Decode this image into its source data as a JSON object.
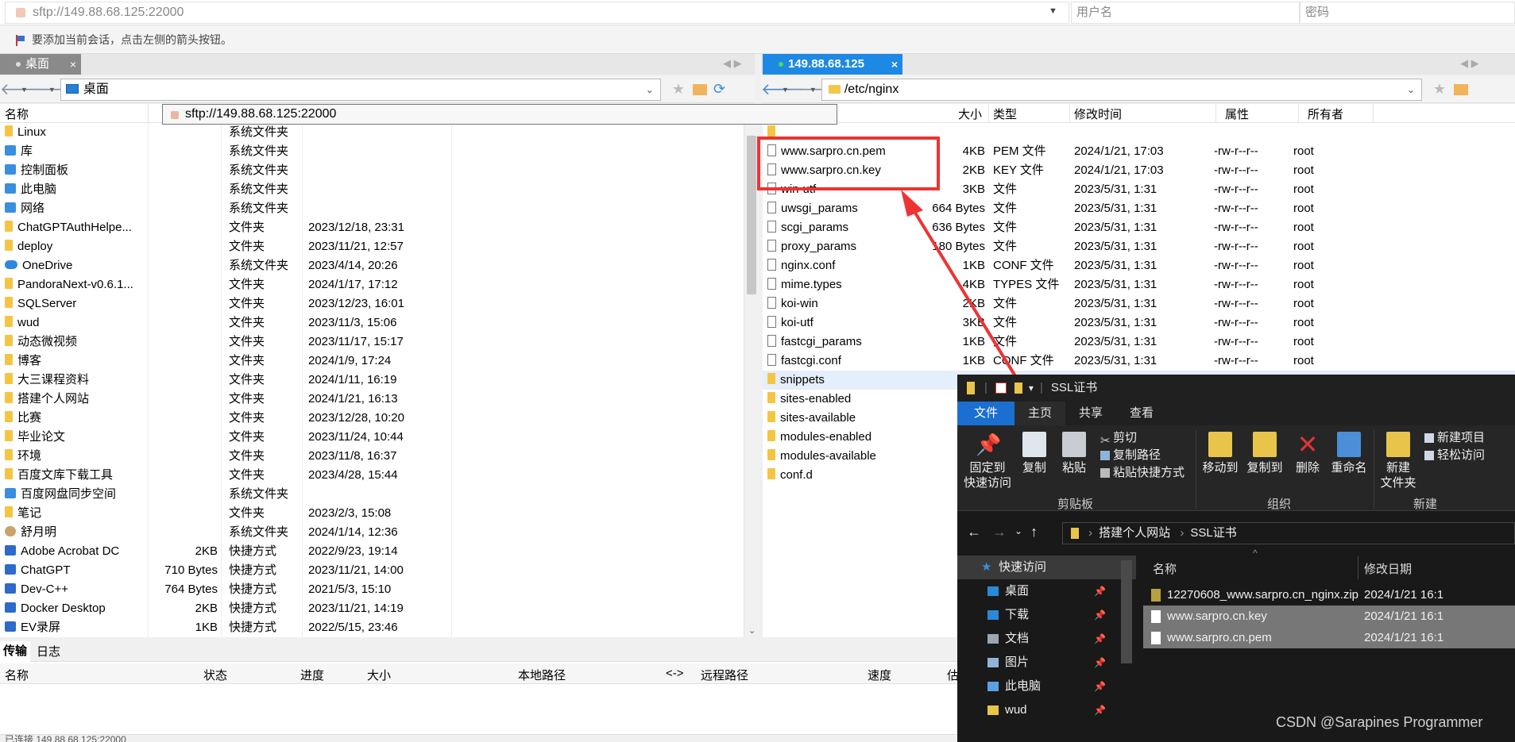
{
  "address": {
    "url": "sftp://149.88.68.125:22000",
    "user_placeholder": "用户名",
    "pass_placeholder": "密码"
  },
  "hint": "要添加当前会话，点击左侧的箭头按钮。",
  "left": {
    "tab": "桌面",
    "path": "桌面",
    "tooltip": "sftp://149.88.68.125:22000",
    "headers": {
      "name": "名称",
      "size": "大小",
      "type": "类型",
      "modified": "修改时间"
    },
    "files": [
      {
        "name": "Linux",
        "size": "",
        "type": "系统文件夹",
        "date": "",
        "icon": "folder"
      },
      {
        "name": "库",
        "size": "",
        "type": "系统文件夹",
        "date": "",
        "icon": "sys"
      },
      {
        "name": "控制面板",
        "size": "",
        "type": "系统文件夹",
        "date": "",
        "icon": "sys"
      },
      {
        "name": "此电脑",
        "size": "",
        "type": "系统文件夹",
        "date": "",
        "icon": "sys"
      },
      {
        "name": "网络",
        "size": "",
        "type": "系统文件夹",
        "date": "",
        "icon": "sys"
      },
      {
        "name": "ChatGPTAuthHelpe...",
        "size": "",
        "type": "文件夹",
        "date": "2023/12/18, 23:31",
        "icon": "folder"
      },
      {
        "name": "deploy",
        "size": "",
        "type": "文件夹",
        "date": "2023/11/21, 12:57",
        "icon": "folder"
      },
      {
        "name": "OneDrive",
        "size": "",
        "type": "系统文件夹",
        "date": "2023/4/14, 20:26",
        "icon": "cloud"
      },
      {
        "name": "PandoraNext-v0.6.1...",
        "size": "",
        "type": "文件夹",
        "date": "2024/1/17, 17:12",
        "icon": "folder"
      },
      {
        "name": "SQLServer",
        "size": "",
        "type": "文件夹",
        "date": "2023/12/23, 16:01",
        "icon": "folder"
      },
      {
        "name": "wud",
        "size": "",
        "type": "文件夹",
        "date": "2023/11/3, 15:06",
        "icon": "folder"
      },
      {
        "name": "动态微视频",
        "size": "",
        "type": "文件夹",
        "date": "2023/11/17, 15:17",
        "icon": "folder"
      },
      {
        "name": "博客",
        "size": "",
        "type": "文件夹",
        "date": "2024/1/9, 17:24",
        "icon": "folder"
      },
      {
        "name": "大三课程资料",
        "size": "",
        "type": "文件夹",
        "date": "2024/1/11, 16:19",
        "icon": "folder"
      },
      {
        "name": "搭建个人网站",
        "size": "",
        "type": "文件夹",
        "date": "2024/1/21, 16:13",
        "icon": "folder"
      },
      {
        "name": "比赛",
        "size": "",
        "type": "文件夹",
        "date": "2023/12/28, 10:20",
        "icon": "folder"
      },
      {
        "name": "毕业论文",
        "size": "",
        "type": "文件夹",
        "date": "2023/11/24, 10:44",
        "icon": "folder"
      },
      {
        "name": "环境",
        "size": "",
        "type": "文件夹",
        "date": "2023/11/8, 16:37",
        "icon": "folder"
      },
      {
        "name": "百度文库下载工具",
        "size": "",
        "type": "文件夹",
        "date": "2023/4/28, 15:44",
        "icon": "folder"
      },
      {
        "name": "百度网盘同步空间",
        "size": "",
        "type": "系统文件夹",
        "date": "",
        "icon": "sys"
      },
      {
        "name": "笔记",
        "size": "",
        "type": "文件夹",
        "date": "2023/2/3, 15:08",
        "icon": "folder"
      },
      {
        "name": "舒月明",
        "size": "",
        "type": "系统文件夹",
        "date": "2024/1/14, 12:36",
        "icon": "user"
      },
      {
        "name": "Adobe Acrobat DC",
        "size": "2KB",
        "type": "快捷方式",
        "date": "2022/9/23, 19:14",
        "icon": "app"
      },
      {
        "name": "ChatGPT",
        "size": "710 Bytes",
        "type": "快捷方式",
        "date": "2023/11/21, 14:00",
        "icon": "app"
      },
      {
        "name": "Dev-C++",
        "size": "764 Bytes",
        "type": "快捷方式",
        "date": "2021/5/3, 15:10",
        "icon": "app"
      },
      {
        "name": "Docker Desktop",
        "size": "2KB",
        "type": "快捷方式",
        "date": "2023/11/21, 14:19",
        "icon": "app"
      },
      {
        "name": "EV录屏",
        "size": "1KB",
        "type": "快捷方式",
        "date": "2022/5/15, 23:46",
        "icon": "app"
      }
    ]
  },
  "right": {
    "tab": "149.88.68.125",
    "path": "/etc/nginx",
    "headers": {
      "size": "大小",
      "type": "类型",
      "modified": "修改时间",
      "attr": "属性",
      "owner": "所有者"
    },
    "files": [
      {
        "name": "www.sarpro.cn.pem",
        "size": "4KB",
        "type": "PEM 文件",
        "date": "2024/1/21, 17:03",
        "attr": "-rw-r--r--",
        "owner": "root",
        "icon": "file"
      },
      {
        "name": "www.sarpro.cn.key",
        "size": "2KB",
        "type": "KEY 文件",
        "date": "2024/1/21, 17:03",
        "attr": "-rw-r--r--",
        "owner": "root",
        "icon": "file"
      },
      {
        "name": "win-utf",
        "size": "3KB",
        "type": "文件",
        "date": "2023/5/31, 1:31",
        "attr": "-rw-r--r--",
        "owner": "root",
        "icon": "file"
      },
      {
        "name": "uwsgi_params",
        "size": "664 Bytes",
        "type": "文件",
        "date": "2023/5/31, 1:31",
        "attr": "-rw-r--r--",
        "owner": "root",
        "icon": "file"
      },
      {
        "name": "scgi_params",
        "size": "636 Bytes",
        "type": "文件",
        "date": "2023/5/31, 1:31",
        "attr": "-rw-r--r--",
        "owner": "root",
        "icon": "file"
      },
      {
        "name": "proxy_params",
        "size": "180 Bytes",
        "type": "文件",
        "date": "2023/5/31, 1:31",
        "attr": "-rw-r--r--",
        "owner": "root",
        "icon": "file"
      },
      {
        "name": "nginx.conf",
        "size": "1KB",
        "type": "CONF 文件",
        "date": "2023/5/31, 1:31",
        "attr": "-rw-r--r--",
        "owner": "root",
        "icon": "file"
      },
      {
        "name": "mime.types",
        "size": "4KB",
        "type": "TYPES 文件",
        "date": "2023/5/31, 1:31",
        "attr": "-rw-r--r--",
        "owner": "root",
        "icon": "file"
      },
      {
        "name": "koi-win",
        "size": "2KB",
        "type": "文件",
        "date": "2023/5/31, 1:31",
        "attr": "-rw-r--r--",
        "owner": "root",
        "icon": "file"
      },
      {
        "name": "koi-utf",
        "size": "3KB",
        "type": "文件",
        "date": "2023/5/31, 1:31",
        "attr": "-rw-r--r--",
        "owner": "root",
        "icon": "file"
      },
      {
        "name": "fastcgi_params",
        "size": "1KB",
        "type": "文件",
        "date": "2023/5/31, 1:31",
        "attr": "-rw-r--r--",
        "owner": "root",
        "icon": "file"
      },
      {
        "name": "fastcgi.conf",
        "size": "1KB",
        "type": "CONF 文件",
        "date": "2023/5/31, 1:31",
        "attr": "-rw-r--r--",
        "owner": "root",
        "icon": "file"
      },
      {
        "name": "snippets",
        "size": "",
        "type": "",
        "date": "",
        "attr": "",
        "owner": "",
        "icon": "folder"
      },
      {
        "name": "sites-enabled",
        "size": "",
        "type": "",
        "date": "",
        "attr": "",
        "owner": "",
        "icon": "folder"
      },
      {
        "name": "sites-available",
        "size": "",
        "type": "",
        "date": "",
        "attr": "",
        "owner": "",
        "icon": "folder"
      },
      {
        "name": "modules-enabled",
        "size": "",
        "type": "",
        "date": "",
        "attr": "",
        "owner": "",
        "icon": "folder"
      },
      {
        "name": "modules-available",
        "size": "",
        "type": "",
        "date": "",
        "attr": "",
        "owner": "",
        "icon": "folder"
      },
      {
        "name": "conf.d",
        "size": "",
        "type": "",
        "date": "",
        "attr": "",
        "owner": "",
        "icon": "folder"
      }
    ]
  },
  "transfer": {
    "tabs": [
      "传输",
      "日志"
    ],
    "headers": [
      "名称",
      "状态",
      "进度",
      "大小",
      "本地路径",
      "<->",
      "远程路径",
      "速度",
      "估"
    ],
    "status": "已连接 149.88.68.125:22000"
  },
  "explorer": {
    "title": "SSL证书",
    "ribbon_tabs": [
      "文件",
      "主页",
      "共享",
      "查看"
    ],
    "buttons": {
      "pin": "固定到\n快速访问",
      "copy": "复制",
      "paste": "粘贴",
      "cut": "剪切",
      "copy_path": "复制路径",
      "paste_shortcut": "粘贴快捷方式",
      "move_to": "移动到",
      "copy_to": "复制到",
      "delete": "删除",
      "rename": "重命名",
      "new_folder": "新建\n文件夹",
      "new_item": "新建项目",
      "easy_access": "轻松访问"
    },
    "groups": [
      "剪贴板",
      "组织",
      "新建"
    ],
    "breadcrumb": [
      "搭建个人网站",
      "SSL证书"
    ],
    "nav": [
      "快速访问",
      "桌面",
      "下载",
      "文档",
      "图片",
      "此电脑",
      "wud"
    ],
    "col_name": "名称",
    "col_date": "修改日期",
    "files": [
      {
        "name": "12270608_www.sarpro.cn_nginx.zip",
        "date": "2024/1/21 16:1"
      },
      {
        "name": "www.sarpro.cn.key",
        "date": "2024/1/21 16:1"
      },
      {
        "name": "www.sarpro.cn.pem",
        "date": "2024/1/21 16:1"
      }
    ]
  },
  "watermark": "CSDN @Sarapines Programmer",
  "colors": {
    "accent_tab": "#1e88e5",
    "highlight": "#ee3333",
    "explorer_bg": "#191919"
  }
}
